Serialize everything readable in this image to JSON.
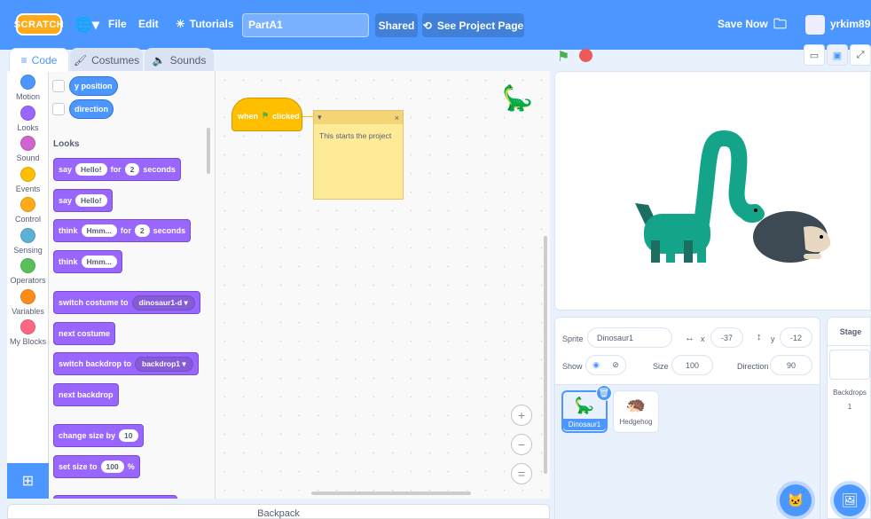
{
  "menubar": {
    "logo": "SCRATCH",
    "file": "File",
    "edit": "Edit",
    "tutorials": "Tutorials",
    "project_title": "PartA1",
    "shared": "Shared",
    "see_project_page": "See Project Page",
    "save_now": "Save Now",
    "username": "yrkim89"
  },
  "tabs": {
    "code": "Code",
    "costumes": "Costumes",
    "sounds": "Sounds"
  },
  "categories": [
    {
      "label": "Motion",
      "color": "#4c97ff"
    },
    {
      "label": "Looks",
      "color": "#9966ff"
    },
    {
      "label": "Sound",
      "color": "#cf63cf"
    },
    {
      "label": "Events",
      "color": "#ffbf00"
    },
    {
      "label": "Control",
      "color": "#ffab19"
    },
    {
      "label": "Sensing",
      "color": "#5cb1d6"
    },
    {
      "label": "Operators",
      "color": "#59c059"
    },
    {
      "label": "Variables",
      "color": "#ff8c1a"
    },
    {
      "label": "My Blocks",
      "color": "#ff6680"
    }
  ],
  "palette": {
    "motion": {
      "y_position": "y position",
      "direction": "direction"
    },
    "looks_title": "Looks",
    "say_for": {
      "say": "say",
      "msg": "Hello!",
      "for": "for",
      "secs": "2",
      "seconds": "seconds"
    },
    "say": {
      "say": "say",
      "msg": "Hello!"
    },
    "think_for": {
      "think": "think",
      "msg": "Hmm...",
      "for": "for",
      "secs": "2",
      "seconds": "seconds"
    },
    "think": {
      "think": "think",
      "msg": "Hmm..."
    },
    "switch_costume": {
      "label": "switch costume to",
      "value": "dinosaur1-d"
    },
    "next_costume": "next costume",
    "switch_backdrop": {
      "label": "switch backdrop to",
      "value": "backdrop1"
    },
    "next_backdrop": "next backdrop",
    "change_size": {
      "label": "change size by",
      "value": "10"
    },
    "set_size": {
      "label": "set size to",
      "value": "100",
      "unit": "%"
    }
  },
  "script": {
    "when": "when",
    "clicked": "clicked",
    "note_text": "This starts the project"
  },
  "zoom": {
    "in": "+",
    "out": "−",
    "reset": "="
  },
  "backpack": "Backpack",
  "sprite_info": {
    "sprite_label": "Sprite",
    "sprite_name": "Dinosaur1",
    "x_label": "x",
    "x_value": "-37",
    "y_label": "y",
    "y_value": "-12",
    "show_label": "Show",
    "size_label": "Size",
    "size_value": "100",
    "direction_label": "Direction",
    "direction_value": "90"
  },
  "sprites": [
    {
      "name": "Dinosaur1",
      "selected": true
    },
    {
      "name": "Hedgehog",
      "selected": false
    }
  ],
  "stage_pane": {
    "title": "Stage",
    "backdrops_label": "Backdrops",
    "backdrops_count": "1"
  }
}
